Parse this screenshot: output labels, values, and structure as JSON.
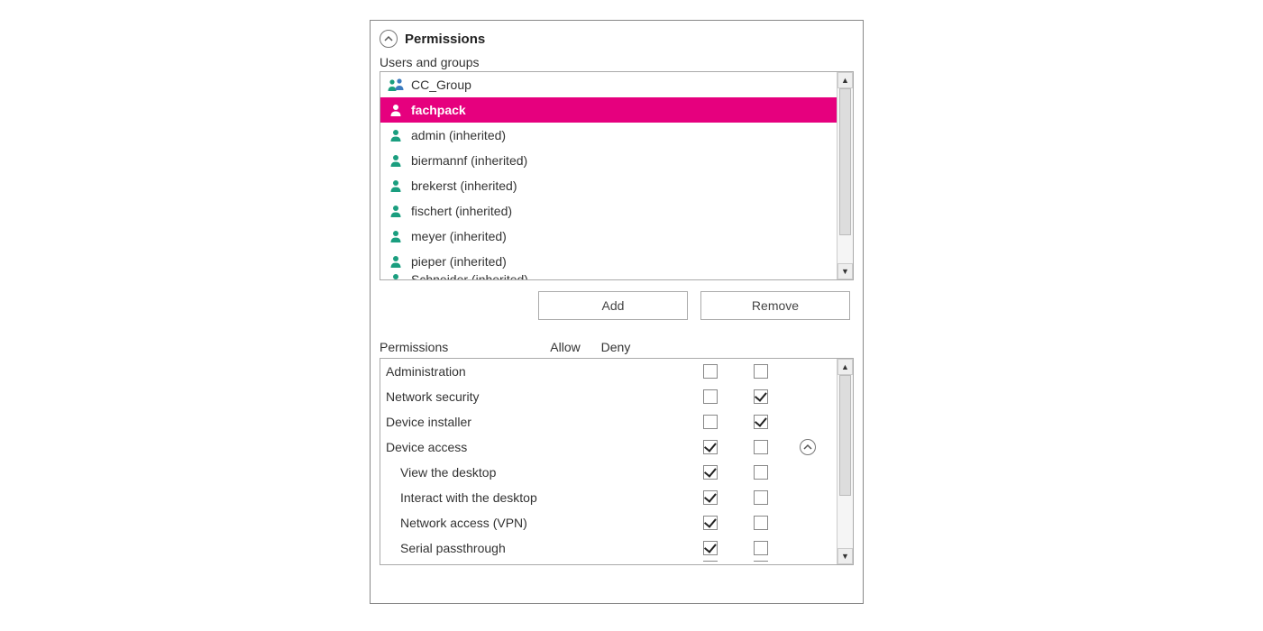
{
  "section": {
    "title": "Permissions",
    "users_label": "Users and groups"
  },
  "users": [
    {
      "name": "CC_Group",
      "type": "group",
      "selected": false
    },
    {
      "name": "fachpack",
      "type": "user",
      "selected": true
    },
    {
      "name": "admin (inherited)",
      "type": "user",
      "selected": false
    },
    {
      "name": "biermannf (inherited)",
      "type": "user",
      "selected": false
    },
    {
      "name": "brekerst (inherited)",
      "type": "user",
      "selected": false
    },
    {
      "name": "fischert (inherited)",
      "type": "user",
      "selected": false
    },
    {
      "name": "meyer (inherited)",
      "type": "user",
      "selected": false
    },
    {
      "name": "pieper (inherited)",
      "type": "user",
      "selected": false
    },
    {
      "name": "Schneider (inherited)",
      "type": "user",
      "selected": false,
      "clipped": true
    }
  ],
  "buttons": {
    "add": "Add",
    "remove": "Remove"
  },
  "perm_header": {
    "label": "Permissions",
    "allow": "Allow",
    "deny": "Deny"
  },
  "permissions": [
    {
      "label": "Administration",
      "allow": false,
      "deny": false,
      "indent": false,
      "expand": false
    },
    {
      "label": "Network security",
      "allow": false,
      "deny": true,
      "indent": false,
      "expand": false
    },
    {
      "label": "Device installer",
      "allow": false,
      "deny": true,
      "indent": false,
      "expand": false
    },
    {
      "label": "Device access",
      "allow": true,
      "deny": false,
      "indent": false,
      "expand": true
    },
    {
      "label": "View the desktop",
      "allow": true,
      "deny": false,
      "indent": true,
      "expand": false
    },
    {
      "label": "Interact with the desktop",
      "allow": true,
      "deny": false,
      "indent": true,
      "expand": false
    },
    {
      "label": "Network access (VPN)",
      "allow": true,
      "deny": false,
      "indent": true,
      "expand": false
    },
    {
      "label": "Serial passthrough",
      "allow": true,
      "deny": false,
      "indent": true,
      "expand": false
    }
  ],
  "colors": {
    "accent": "#e6007e",
    "user_icon": "#1a9e7f",
    "group_icon_a": "#1a9e7f",
    "group_icon_b": "#3b7bbf"
  }
}
